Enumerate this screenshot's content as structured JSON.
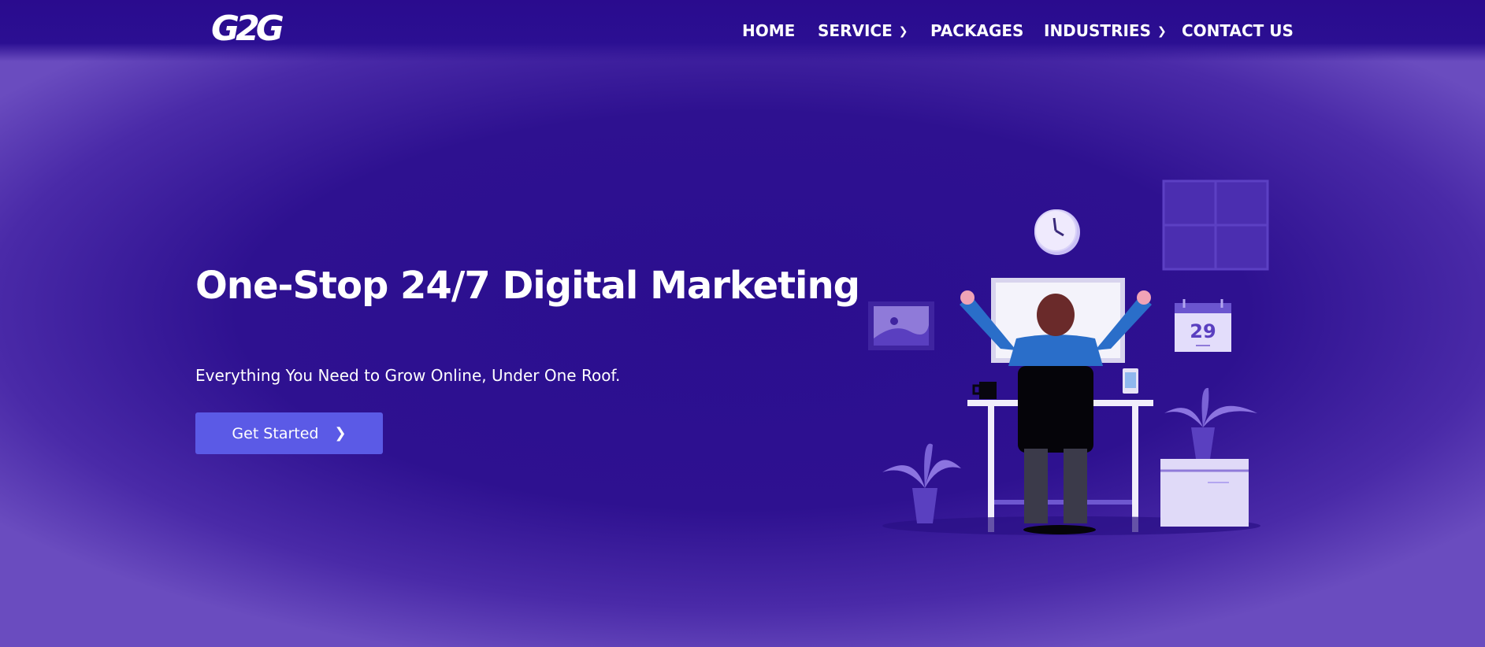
{
  "brand": {
    "logo_text": "G2G"
  },
  "nav": {
    "items": [
      {
        "label": "HOME",
        "has_dropdown": false
      },
      {
        "label": "SERVICE",
        "has_dropdown": true
      },
      {
        "label": "PACKAGES",
        "has_dropdown": false
      },
      {
        "label": "INDUSTRIES",
        "has_dropdown": true
      },
      {
        "label": "CONTACT US",
        "has_dropdown": false
      }
    ]
  },
  "hero": {
    "title": "One-Stop 24/7 Digital Marketing",
    "subtitle": "Everything You Need to Grow Online, Under One Roof.",
    "cta_label": "Get Started",
    "cta_icon": "chevron-right-icon"
  },
  "illustration": {
    "calendar_day": "29",
    "icons": [
      "clock-icon",
      "window-icon",
      "calendar-icon",
      "picture-frame-icon",
      "plant-icon",
      "person-at-desk-illustration"
    ]
  },
  "colors": {
    "background": "#2e1190",
    "header": "#2a0b8e",
    "cta": "#5b5ae6",
    "accent_light": "#b3a6f0"
  }
}
